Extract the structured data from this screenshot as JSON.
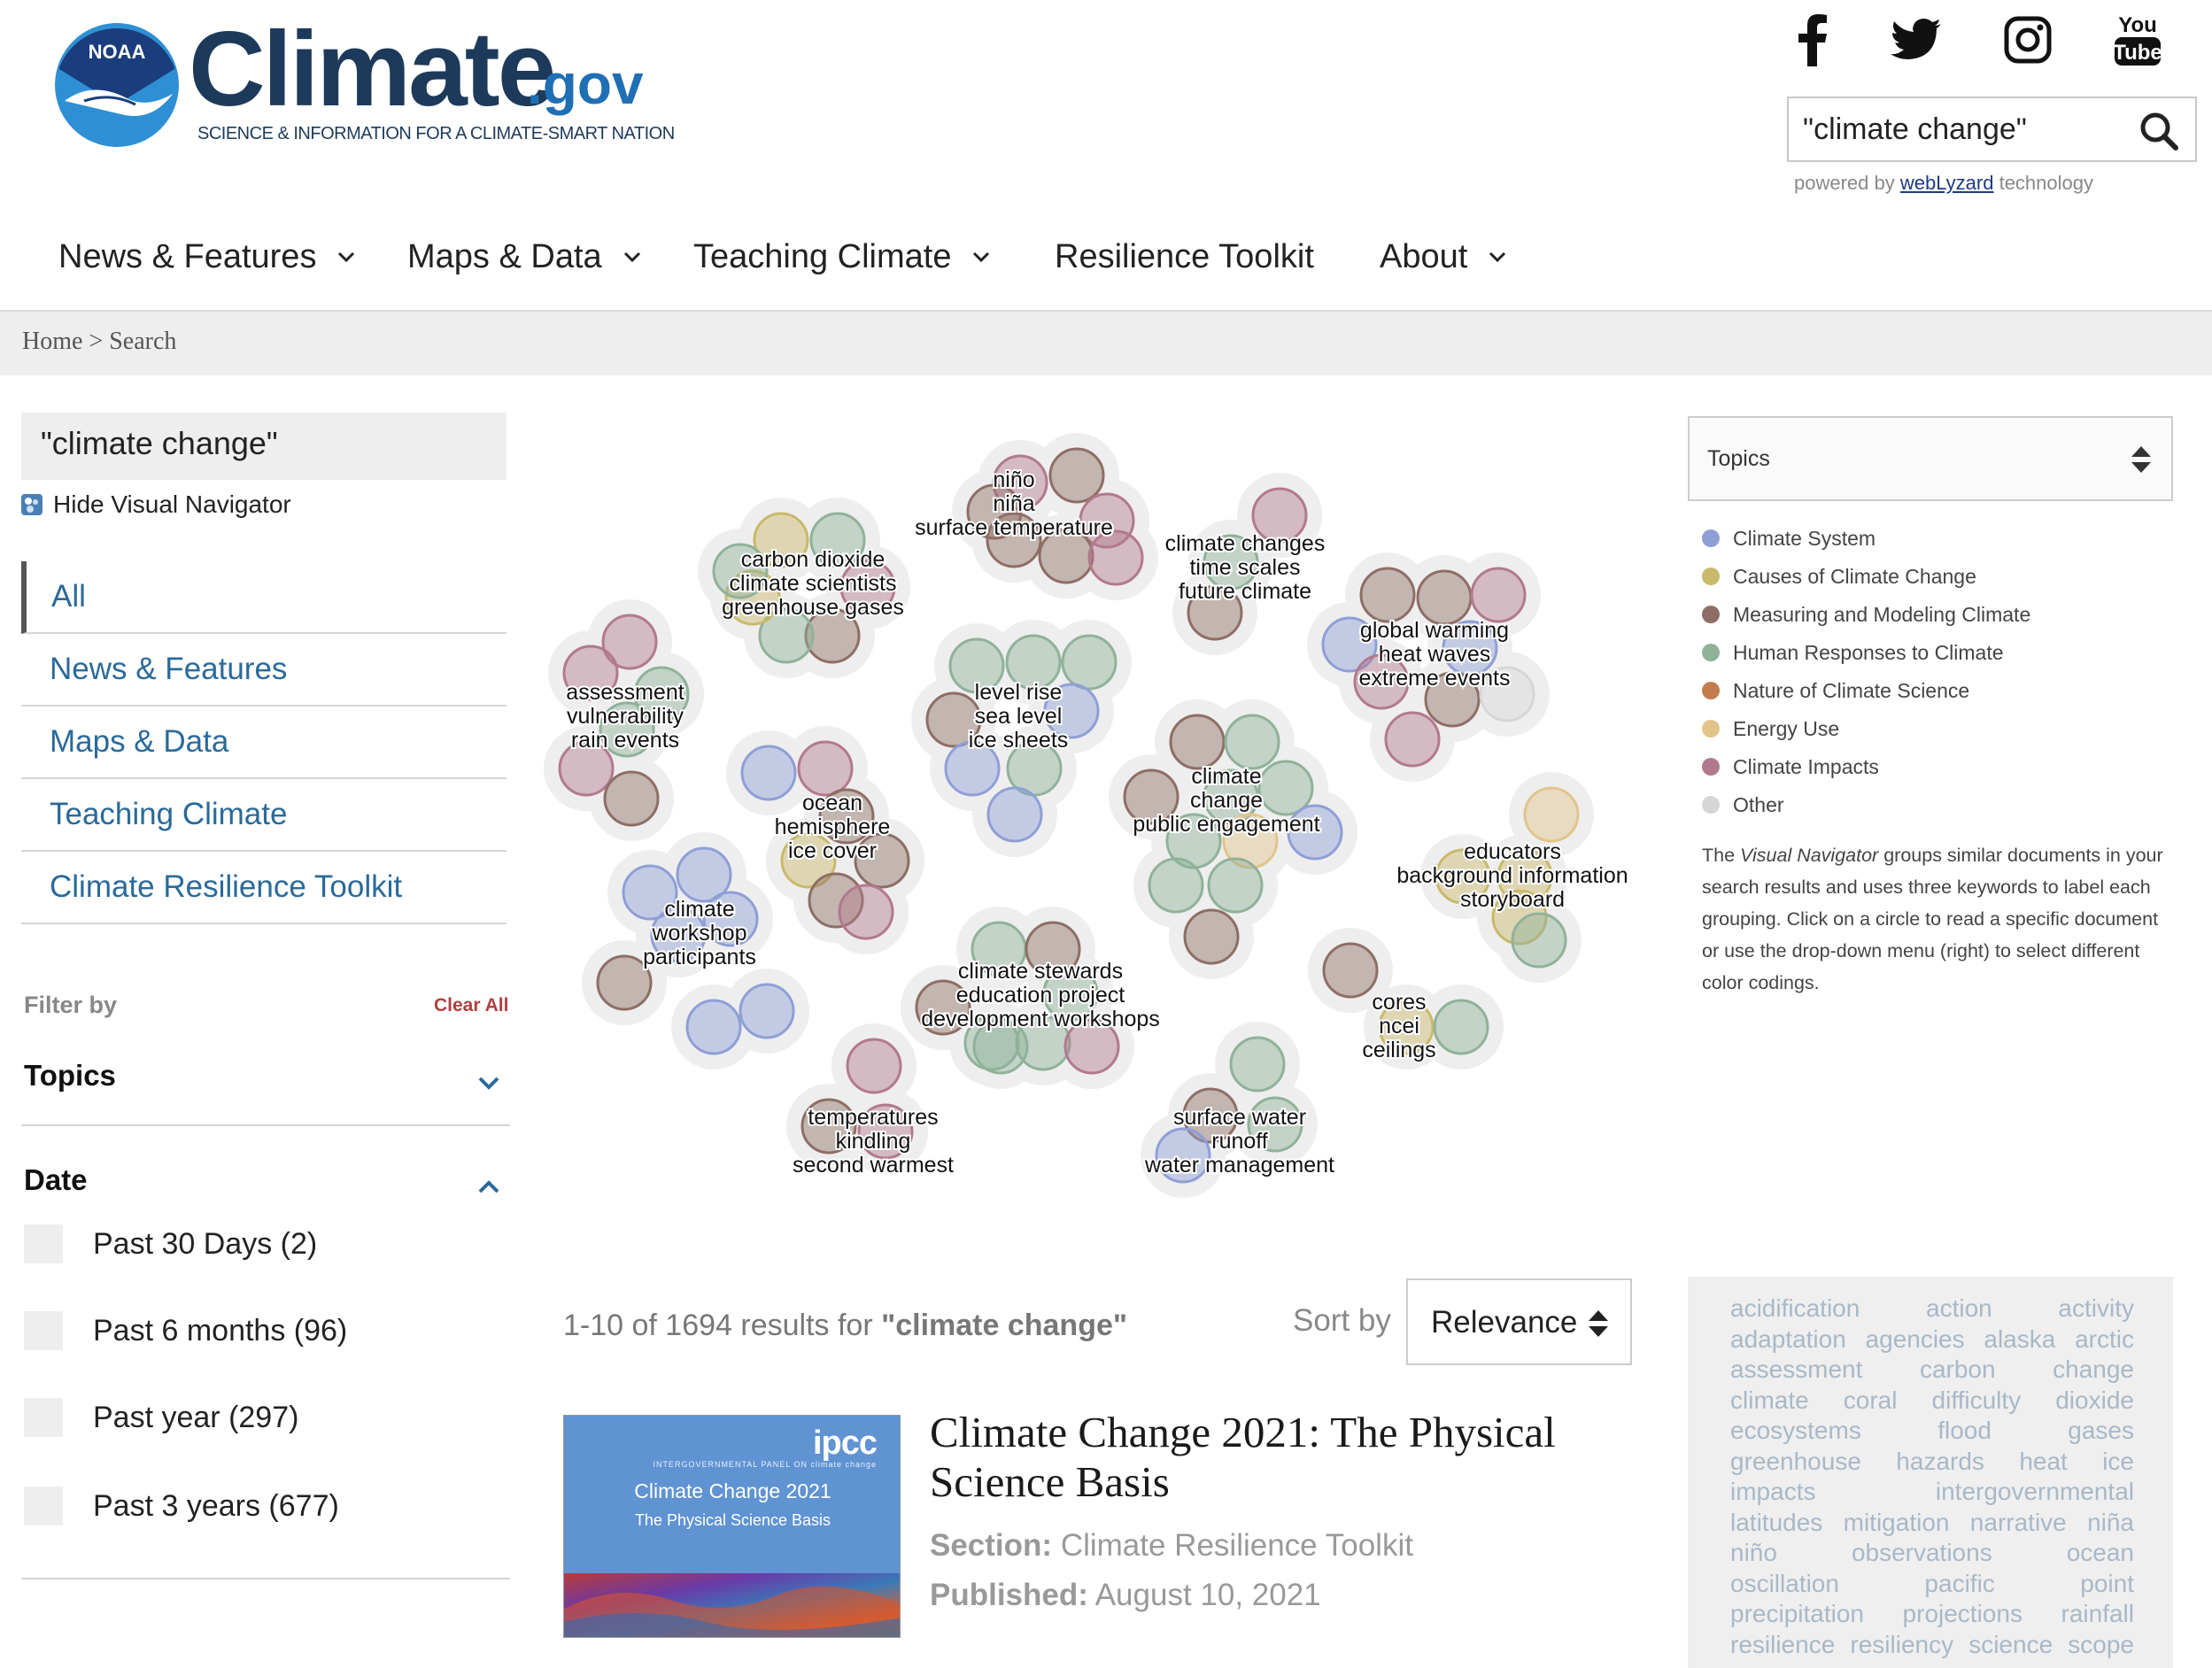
{
  "site": {
    "emblem_text": "NOAA",
    "title": "Climate",
    "title_suffix": ".gov",
    "tagline": "SCIENCE & INFORMATION FOR A CLIMATE-SMART NATION"
  },
  "social": [
    "facebook-icon",
    "twitter-icon",
    "instagram-icon",
    "youtube-icon"
  ],
  "youtube_label": [
    "You",
    "Tube"
  ],
  "search": {
    "value": "\"climate change\"",
    "powered_prefix": "powered by",
    "powered_link": "webLyzard",
    "powered_suffix": "technology"
  },
  "nav": [
    {
      "label": "News & Features",
      "dropdown": true
    },
    {
      "label": "Maps & Data",
      "dropdown": true
    },
    {
      "label": "Teaching Climate",
      "dropdown": true
    },
    {
      "label": "Resilience Toolkit",
      "dropdown": false
    },
    {
      "label": "About",
      "dropdown": true
    }
  ],
  "breadcrumb": {
    "home": "Home",
    "sep": ">",
    "current": "Search"
  },
  "left": {
    "query": "\"climate change\"",
    "hide_navigator": "Hide Visual Navigator",
    "sections": [
      "All",
      "News & Features",
      "Maps & Data",
      "Teaching Climate",
      "Climate Resilience Toolkit"
    ],
    "filter_by": "Filter by",
    "clear_all": "Clear All",
    "topics": "Topics",
    "date": "Date",
    "date_options": [
      "Past 30 Days (2)",
      "Past 6 months (96)",
      "Past year (297)",
      "Past 3 years (677)"
    ]
  },
  "colors": {
    "Climate System": "#8e9fd6",
    "Causes of Climate Change": "#c9b96a",
    "Measuring and Modeling Climate": "#8e6e64",
    "Human Responses to Climate": "#8fb299",
    "Nature of Climate Science": "#c37c4d",
    "Energy Use": "#e2c48a",
    "Climate Impacts": "#b2798e",
    "Other": "#d6d6d6"
  },
  "legend": {
    "select_label": "Topics",
    "items": [
      "Climate System",
      "Causes of Climate Change",
      "Measuring and Modeling Climate",
      "Human Responses to Climate",
      "Nature of Climate Science",
      "Energy Use",
      "Climate Impacts",
      "Other"
    ],
    "desc_a": "The",
    "desc_italic": "Visual Navigator",
    "desc_b": "groups similar documents in your search results and uses three keywords to label each grouping. Click on a circle to read a specific document or use the drop-down menu (right) to select different color codings."
  },
  "clusters": [
    {
      "labels": [
        "niño",
        "niña",
        "surface temperature"
      ],
      "circles": [
        "Climate Impacts",
        "Measuring and Modeling Climate",
        "Climate Impacts",
        "Measuring and Modeling Climate",
        "Measuring and Modeling Climate",
        "Measuring and Modeling Climate",
        "Climate Impacts"
      ]
    },
    {
      "labels": [
        "carbon dioxide",
        "climate scientists",
        "greenhouse gases"
      ],
      "circles": [
        "Causes of Climate Change",
        "Human Responses to Climate",
        "Climate Impacts",
        "Measuring and Modeling Climate",
        "Human Responses to Climate",
        "Causes of Climate Change",
        "Human Responses to Climate"
      ]
    },
    {
      "labels": [
        "climate changes",
        "time scales",
        "future climate"
      ],
      "circles": [
        "Climate Impacts",
        "Human Responses to Climate",
        "Measuring and Modeling Climate"
      ]
    },
    {
      "labels": [
        "assessment",
        "vulnerability",
        "rain events"
      ],
      "circles": [
        "Climate Impacts",
        "Human Responses to Climate",
        "Human Responses to Climate",
        "Climate Impacts",
        "Measuring and Modeling Climate",
        "Climate Impacts",
        "Climate Impacts"
      ]
    },
    {
      "labels": [
        "global warming",
        "heat waves",
        "extreme events"
      ],
      "circles": [
        "Measuring and Modeling Climate",
        "Measuring and Modeling Climate",
        "Climate Impacts",
        "Climate System",
        "Climate System",
        "Climate Impacts",
        "Measuring and Modeling Climate",
        "Other",
        "Climate Impacts"
      ]
    },
    {
      "labels": [
        "level rise",
        "sea level",
        "ice sheets"
      ],
      "circles": [
        "Human Responses to Climate",
        "Human Responses to Climate",
        "Human Responses to Climate",
        "Measuring and Modeling Climate",
        "Climate System",
        "Climate System",
        "Human Responses to Climate",
        "Climate System"
      ]
    },
    {
      "labels": [
        "ocean",
        "hemisphere",
        "ice cover"
      ],
      "circles": [
        "Climate System",
        "Climate Impacts",
        "Measuring and Modeling Climate",
        "Causes of Climate Change",
        "Measuring and Modeling Climate",
        "Measuring and Modeling Climate",
        "Climate Impacts"
      ]
    },
    {
      "labels": [
        "climate",
        "change",
        "public engagement"
      ],
      "circles": [
        "Measuring and Modeling Climate",
        "Human Responses to Climate",
        "Human Responses to Climate",
        "Measuring and Modeling Climate",
        "Human Responses to Climate",
        "Human Responses to Climate",
        "Energy Use",
        "Climate System",
        "Human Responses to Climate",
        "Human Responses to Climate",
        "Measuring and Modeling Climate"
      ]
    },
    {
      "labels": [
        "educators",
        "background information",
        "storyboard"
      ],
      "circles": [
        "Energy Use",
        "Causes of Climate Change",
        "Causes of Climate Change",
        "Causes of Climate Change",
        "Human Responses to Climate"
      ]
    },
    {
      "labels": [
        "climate",
        "workshop",
        "participants"
      ],
      "circles": [
        "Climate System",
        "Climate System",
        "Climate System",
        "Measuring and Modeling Climate",
        "Climate System",
        "Climate System",
        "Climate System"
      ]
    },
    {
      "labels": [
        "climate stewards",
        "education project",
        "development workshops"
      ],
      "circles": [
        "Human Responses to Climate",
        "Measuring and Modeling Climate",
        "Human Responses to Climate",
        "Measuring and Modeling Climate",
        "Human Responses to Climate",
        "Human Responses to Climate",
        "Climate Impacts",
        "Human Responses to Climate"
      ]
    },
    {
      "labels": [
        "cores",
        "ncei",
        "ceilings"
      ],
      "circles": [
        "Measuring and Modeling Climate",
        "Causes of Climate Change",
        "Human Responses to Climate"
      ]
    },
    {
      "labels": [
        "temperatures",
        "kindling",
        "second warmest"
      ],
      "circles": [
        "Climate Impacts",
        "Measuring and Modeling Climate",
        "Climate Impacts"
      ]
    },
    {
      "labels": [
        "surface water",
        "runoff",
        "water management"
      ],
      "circles": [
        "Human Responses to Climate",
        "Measuring and Modeling Climate",
        "Human Responses to Climate",
        "Climate System"
      ]
    }
  ],
  "results": {
    "count_text": "1-10 of 1694 results for",
    "count_query": "\"climate change\"",
    "sort_label": "Sort by",
    "sort_value": "Relevance",
    "item": {
      "thumb_logo": "ipcc",
      "thumb_sub": "INTERGOVERNMENTAL PANEL ON climate change",
      "thumb_title": "Climate Change 2021",
      "thumb_subtitle": "The Physical Science Basis",
      "title": "Climate Change 2021: The Physical Science Basis",
      "section_label": "Section:",
      "section_value": "Climate Resilience Toolkit",
      "published_label": "Published:",
      "published_value": "August 10, 2021"
    }
  },
  "tag_cloud": [
    [
      "acidification",
      "action",
      "activity"
    ],
    [
      "adaptation",
      "agencies",
      "alaska",
      "arctic"
    ],
    [
      "assessment",
      "carbon",
      "change"
    ],
    [
      "climate",
      "coral",
      "difficulty",
      "dioxide"
    ],
    [
      "ecosystems",
      "flood",
      "gases"
    ],
    [
      "greenhouse",
      "hazards",
      "heat",
      "ice"
    ],
    [
      "impacts",
      "intergovernmental"
    ],
    [
      "latitudes",
      "mitigation",
      "narrative",
      "niña"
    ],
    [
      "niño",
      "observations",
      "ocean"
    ],
    [
      "oscillation",
      "pacific",
      "point"
    ],
    [
      "precipitation",
      "projections",
      "rainfall"
    ],
    [
      "resilience",
      "resiliency",
      "science",
      "scope"
    ]
  ]
}
